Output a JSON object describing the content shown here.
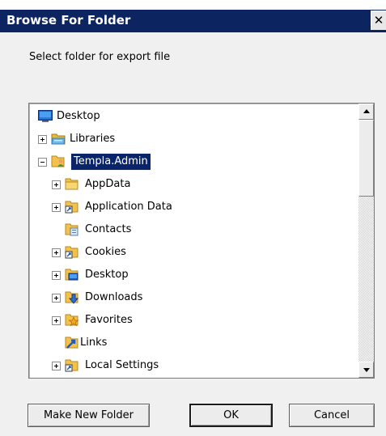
{
  "window": {
    "title": "Browse For Folder",
    "close_glyph": "✕"
  },
  "instruction": "Select folder for export file",
  "tree": {
    "items": [
      {
        "label": "Desktop",
        "icon": "desktop-icon",
        "expander": "none",
        "selected": false
      },
      {
        "label": "Libraries",
        "icon": "libraries-icon",
        "expander": "plus",
        "selected": false
      },
      {
        "label": "Templa.Admin",
        "icon": "user-folder-icon",
        "expander": "minus",
        "selected": true
      },
      {
        "label": "AppData",
        "icon": "folder-icon",
        "expander": "plus",
        "selected": false
      },
      {
        "label": "Application Data",
        "icon": "shortcut-folder-icon",
        "expander": "plus",
        "selected": false
      },
      {
        "label": "Contacts",
        "icon": "contacts-folder-icon",
        "expander": "none",
        "selected": false
      },
      {
        "label": "Cookies",
        "icon": "shortcut-folder-icon",
        "expander": "plus",
        "selected": false
      },
      {
        "label": "Desktop",
        "icon": "desktop-folder-icon",
        "expander": "plus",
        "selected": false
      },
      {
        "label": "Downloads",
        "icon": "downloads-folder-icon",
        "expander": "plus",
        "selected": false
      },
      {
        "label": "Favorites",
        "icon": "favorites-folder-icon",
        "expander": "plus",
        "selected": false
      },
      {
        "label": "Links",
        "icon": "links-folder-icon",
        "expander": "none",
        "selected": false
      },
      {
        "label": "Local Settings",
        "icon": "shortcut-folder-icon",
        "expander": "plus",
        "selected": false
      }
    ]
  },
  "buttons": {
    "make_new_folder": "Make New Folder",
    "ok": "OK",
    "cancel": "Cancel"
  },
  "colors": {
    "titlebar": "#0c2460",
    "selection": "#0a246a",
    "dialog_bg": "#f0f0f0",
    "folder": "#f2c24a"
  }
}
